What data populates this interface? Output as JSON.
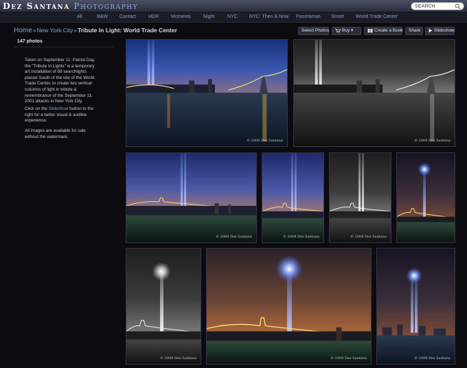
{
  "brand": {
    "part1": "Dez Santana",
    "part2": "Photography"
  },
  "search": {
    "placeholder": "SEARCH"
  },
  "nav": [
    "All",
    "B&W",
    "Contact",
    "HDR",
    "Moments",
    "Night",
    "NYC",
    "NYC: Then & Now",
    "Panoramas",
    "Street",
    "World Trade Center"
  ],
  "breadcrumb": {
    "home": "Home",
    "sep": "»",
    "level1": "New York City",
    "current": "Tribute In Light: World Trade Center"
  },
  "toolbar": {
    "select_photos": "Select Photos",
    "buy": "Buy ▾",
    "create_book": "Create a Book",
    "share": "Share",
    "slideshow": "Slideshow"
  },
  "sidebar": {
    "photo_count": "147 photos",
    "para1": "Taken on September 11: Patriot Day, the \"Tribute In Lights\" is a temporary art installation of 88 searchlights placed South of the site of the World Trade Center, to create two vertical columns of light in tribute & remembrance of the September 11, 2001 attacks in New York City.",
    "para2_pre": "Click on the ",
    "para2_link": "Slideshow",
    "para2_post": " button to the right for a better visual & audible experience.",
    "para3": "All images are available for sale without the watermark."
  },
  "watermark": "© 2008 Dez Santana",
  "photos": [
    {
      "name": "Tribute in light – Brooklyn Bridge at dusk (color)"
    },
    {
      "name": "Tribute in light – Brooklyn Bridge (black & white)"
    },
    {
      "name": "Tribute in light – Brooklyn Bridge, wide"
    },
    {
      "name": "Tribute in light – vertical color"
    },
    {
      "name": "Tribute in light – vertical B&W"
    },
    {
      "name": "Tribute in light – vertical night"
    },
    {
      "name": "Tribute in light – B&W glow"
    },
    {
      "name": "Tribute in light – Brooklyn Bridge orange sky"
    },
    {
      "name": "Tribute in light – skyline blue beams"
    }
  ],
  "colors": {
    "background": "#0c0c10",
    "link": "#8ea2d8",
    "header": "#3a3e50"
  }
}
